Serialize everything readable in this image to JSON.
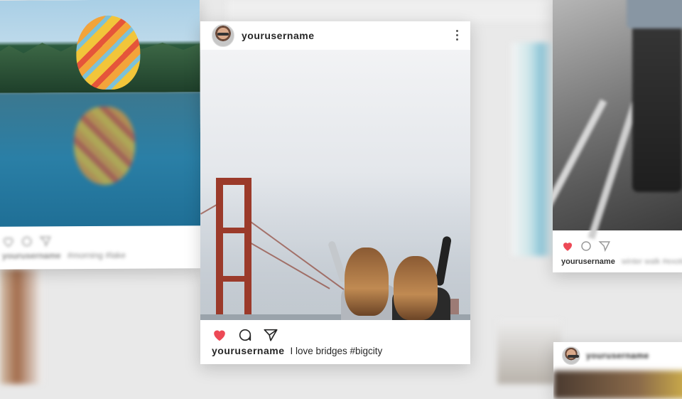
{
  "main_post": {
    "username": "yourusername",
    "caption_username": "yourusername",
    "caption_text": "I love bridges #bigcity",
    "like_color": "#ed4956",
    "icons": {
      "like": "heart-icon",
      "comment": "comment-icon",
      "share": "send-icon",
      "more": "more-options-icon"
    }
  },
  "left_post": {
    "username": "yourusername",
    "caption_text": "#morning #lake"
  },
  "right_post": {
    "username": "yourusername",
    "caption_text": "winter walk #exotic"
  },
  "bottom_right_post": {
    "username": "yourusername"
  }
}
